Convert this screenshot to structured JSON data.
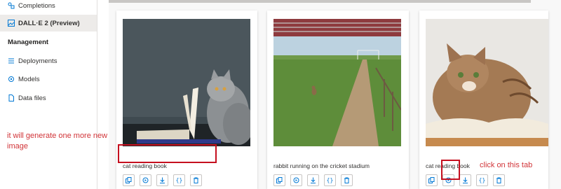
{
  "sidebar": {
    "items": [
      {
        "label": "Completions",
        "icon": "completions-icon"
      },
      {
        "label": "DALL·E 2 (Preview)",
        "icon": "dalle-icon",
        "active": true
      }
    ],
    "section_title": "Management",
    "management_items": [
      {
        "label": "Deployments",
        "icon": "deployments-icon"
      },
      {
        "label": "Models",
        "icon": "models-icon"
      },
      {
        "label": "Data files",
        "icon": "data-files-icon"
      }
    ]
  },
  "images": [
    {
      "caption": "cat reading book",
      "scene": "cat-reading-dark"
    },
    {
      "caption": "rabbit running on the cricket stadium",
      "scene": "rabbit-stadium"
    },
    {
      "caption": "cat reading book",
      "scene": "cat-reading-light"
    }
  ],
  "actions": [
    {
      "name": "copy-icon",
      "title": "Copy"
    },
    {
      "name": "regenerate-icon",
      "title": "Generate more"
    },
    {
      "name": "download-icon",
      "title": "Download"
    },
    {
      "name": "json-icon",
      "title": "View code"
    },
    {
      "name": "delete-icon",
      "title": "Delete"
    }
  ],
  "annotations": {
    "left_note": "it will generate one more new image",
    "right_note": "click on this tab"
  },
  "colors": {
    "annotation": "#d13438",
    "accent": "#0078d4"
  }
}
